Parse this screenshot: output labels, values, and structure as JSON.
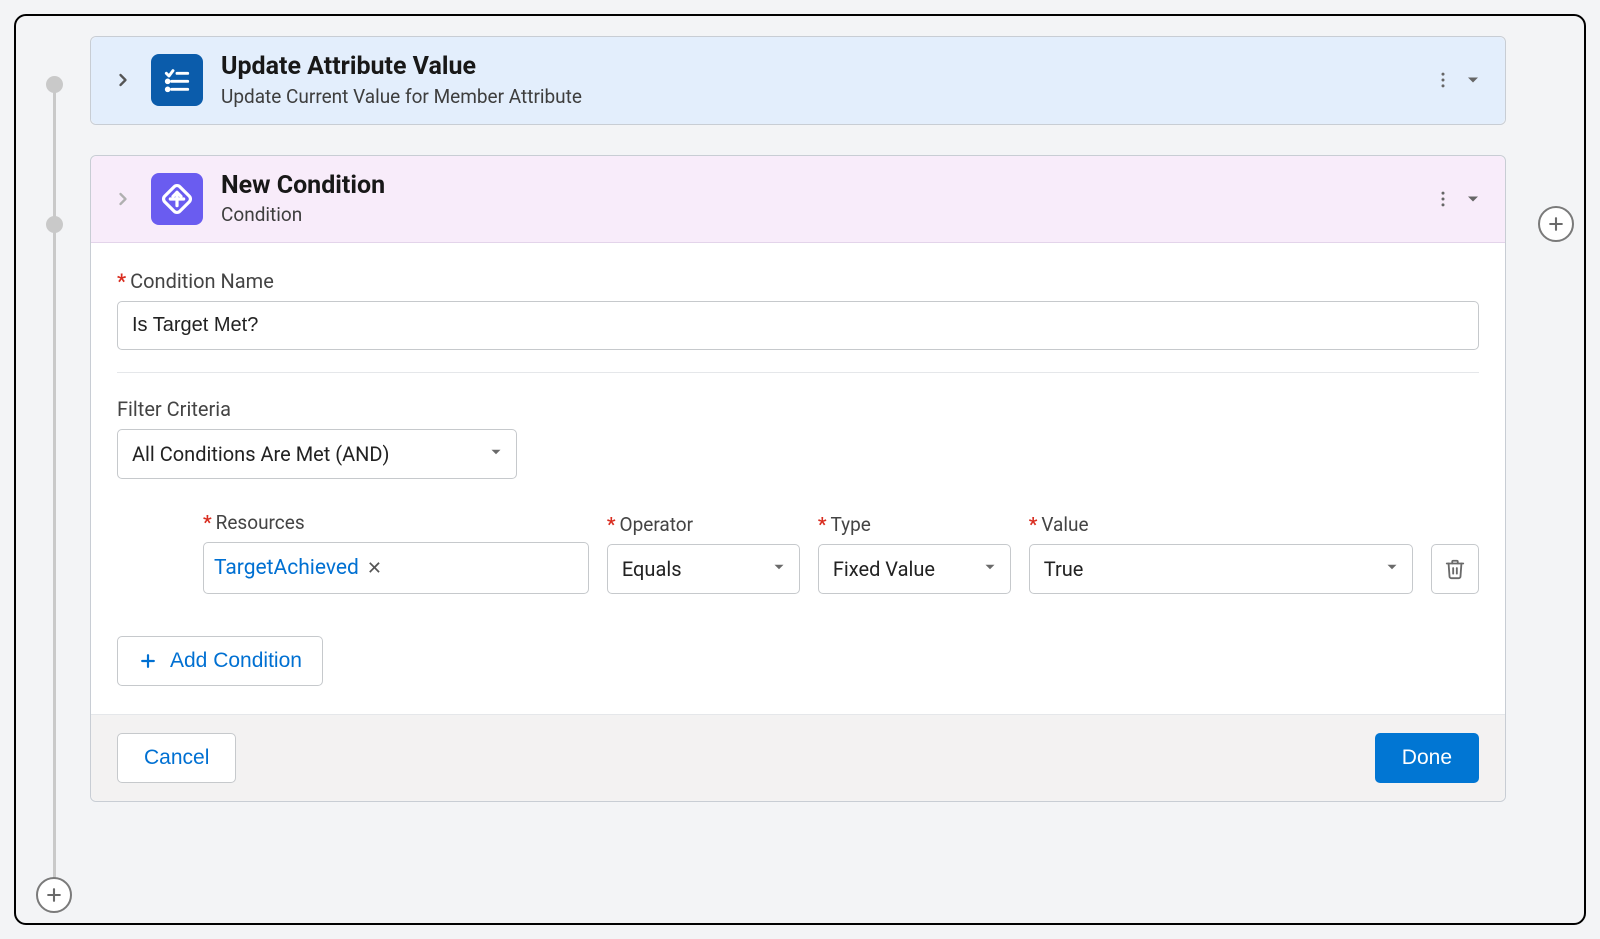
{
  "step1": {
    "title": "Update Attribute Value",
    "subtitle": "Update Current Value for Member Attribute"
  },
  "step2": {
    "title": "New Condition",
    "subtitle": "Condition",
    "name_label": "Condition Name",
    "name_value": "Is Target Met?",
    "filter_label": "Filter Criteria",
    "filter_value": "All Conditions Are Met (AND)",
    "row": {
      "resources_label": "Resources",
      "resources_value": "TargetAchieved",
      "operator_label": "Operator",
      "operator_value": "Equals",
      "type_label": "Type",
      "type_value": "Fixed Value",
      "value_label": "Value",
      "value_value": "True"
    },
    "add_condition_label": "Add Condition"
  },
  "buttons": {
    "cancel": "Cancel",
    "done": "Done"
  }
}
